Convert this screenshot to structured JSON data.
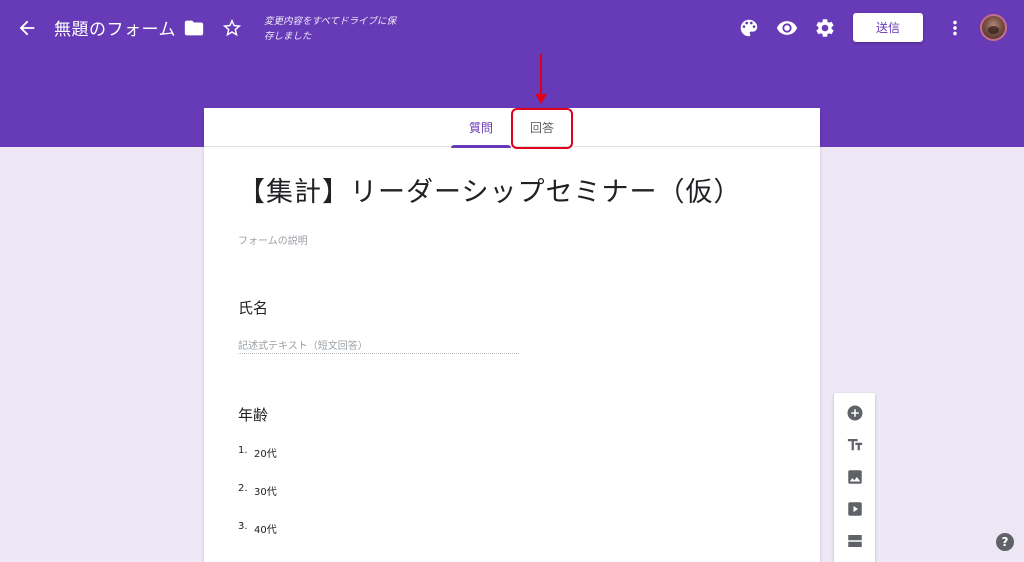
{
  "topbar": {
    "form_name": "無題のフォーム",
    "save_status": "変更内容をすべてドライブに保存しました",
    "send_label": "送信",
    "icons": [
      "back-arrow-icon",
      "folder-icon",
      "star-icon",
      "palette-icon",
      "eye-icon",
      "gear-icon",
      "more-vert-icon"
    ]
  },
  "tabs": {
    "questions": "質問",
    "responses": "回答",
    "active": "質問"
  },
  "form": {
    "title": "【集計】リーダーシップセミナー（仮）",
    "description_placeholder": "フォームの説明",
    "questions": [
      {
        "title": "氏名",
        "answer_placeholder": "記述式テキスト（短文回答）"
      },
      {
        "title": "年齢",
        "options": [
          {
            "num": "1.",
            "label": "20代"
          },
          {
            "num": "2.",
            "label": "30代"
          },
          {
            "num": "3.",
            "label": "40代"
          }
        ]
      }
    ]
  },
  "side_toolbar": {
    "icons": [
      "add-circle-icon",
      "title-text-icon",
      "image-icon",
      "video-icon",
      "section-icon"
    ]
  },
  "help": {
    "label": "?"
  },
  "colors": {
    "theme": "#673ab7",
    "background": "#ede7f6",
    "annotation": "#e0001b"
  }
}
